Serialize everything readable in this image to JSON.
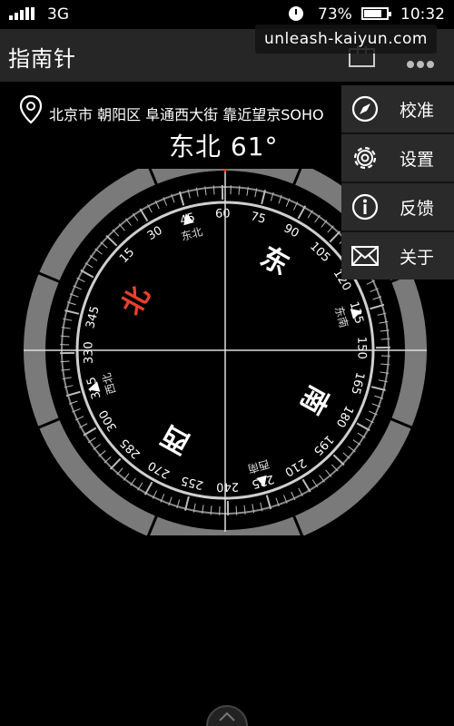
{
  "status": {
    "network": "3G",
    "battery": "73%",
    "time": "10:32"
  },
  "watermark": "unleash-kaiyun.com",
  "appbar": {
    "title": "指南针"
  },
  "location": {
    "text": "北京市 朝阳区 阜通西大街 靠近望京SOHO"
  },
  "heading": {
    "text": "东北 61°"
  },
  "compass": {
    "ticks_labels": [
      "15",
      "30",
      "45",
      "60",
      "75",
      "90",
      "105",
      "120",
      "135",
      "150",
      "165",
      "180",
      "195",
      "210",
      "225",
      "240",
      "255",
      "270",
      "285",
      "300",
      "315",
      "330",
      "345"
    ],
    "cardinals": {
      "north": "北",
      "east": "东",
      "south": "南",
      "west": "西"
    },
    "intercardinals": {
      "northeast": "东北",
      "southeast": "东南",
      "southwest": "西南",
      "northwest": "西北"
    },
    "heading_deg": 61,
    "accent_color": "#e8402a"
  },
  "menu": {
    "items": [
      {
        "label": "校准",
        "icon": "compass-calibrate-icon"
      },
      {
        "label": "设置",
        "icon": "gear-icon"
      },
      {
        "label": "反馈",
        "icon": "info-icon"
      },
      {
        "label": "关于",
        "icon": "mail-icon"
      }
    ]
  }
}
